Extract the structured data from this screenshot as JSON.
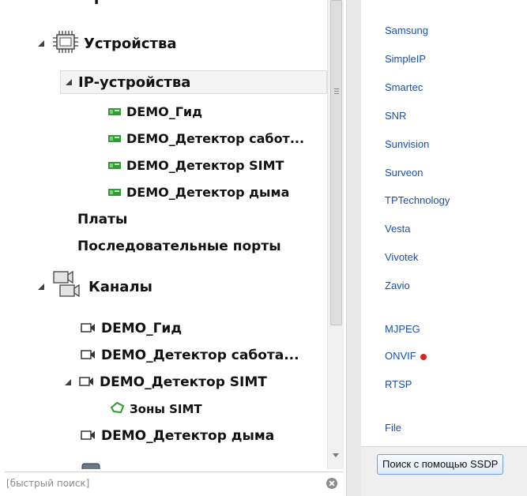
{
  "tree": {
    "partial_top_label": "Т",
    "devices": {
      "label": "Устройства"
    },
    "ip_devices": {
      "label": "IP-устройства"
    },
    "ip_items": [
      {
        "label": "DEMO_Гид"
      },
      {
        "label": "DEMO_Детектор сабот..."
      },
      {
        "label": "DEMO_Детектор SIMT"
      },
      {
        "label": "DEMO_Детектор дыма"
      }
    ],
    "boards": {
      "label": "Платы"
    },
    "serial_ports": {
      "label": "Последовательные порты"
    },
    "channels": {
      "label": "Каналы"
    },
    "channel_items": [
      {
        "label": "DEMO_Гид"
      },
      {
        "label": "DEMO_Детектор сабота..."
      },
      {
        "label": "DEMO_Детектор SIMT"
      },
      {
        "label": "DEMO_Детектор дыма"
      }
    ],
    "zones": {
      "label": "Зоны SIMT"
    }
  },
  "search": {
    "placeholder": "[быстрый поиск]"
  },
  "vendors": [
    "Samsung",
    "SimpleIP",
    "Smartec",
    "SNR",
    "Sunvision",
    "Surveon",
    "TPTechnology",
    "Vesta",
    "Vivotek",
    "Zavio"
  ],
  "protocols": [
    "MJPEG",
    "ONVIF",
    "RTSP"
  ],
  "file_item": "File",
  "ssdp_button_label": "Поиск с помощью SSDP",
  "colors": {
    "vendor_link": "#1c4fa8",
    "onvif_indicator": "#e02424",
    "device_chip": "#2e9e2e",
    "button_border": "#6f9fd8"
  }
}
